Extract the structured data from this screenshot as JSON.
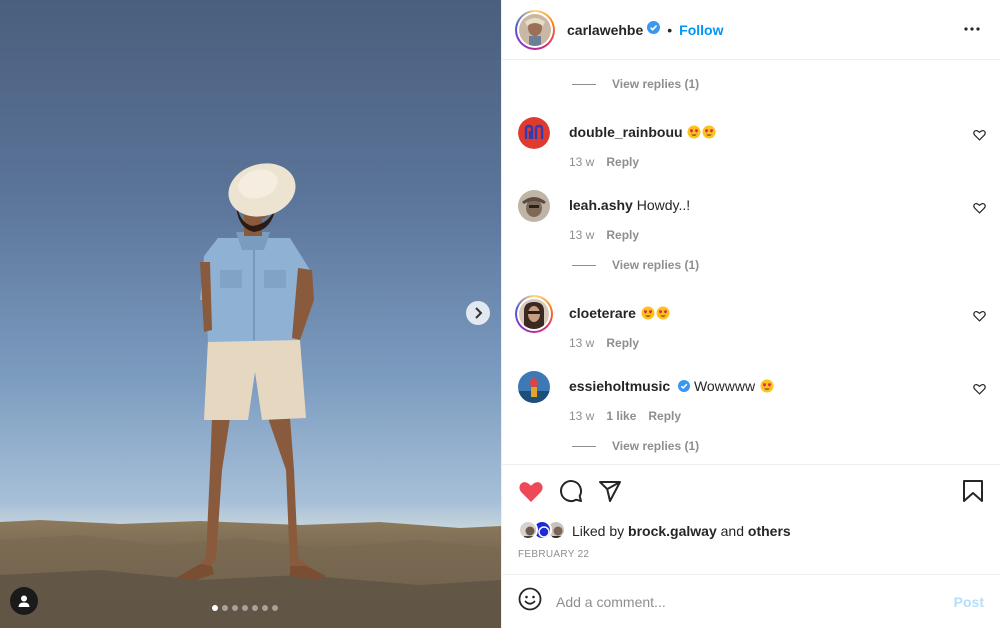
{
  "post": {
    "username": "carlawehbe",
    "dot": "•",
    "follow_label": "Follow",
    "carousel": {
      "total_slides": 7,
      "active_index": 0
    }
  },
  "comments": {
    "view_replies_1": "View replies (1)",
    "items": [
      {
        "username": "double_rainbouu",
        "text": "",
        "emojis": 2,
        "time": "13 w",
        "likes": "",
        "reply": "Reply"
      },
      {
        "username": "leah.ashy",
        "text": "Howdy..!",
        "emojis": 0,
        "time": "13 w",
        "likes": "",
        "reply": "Reply"
      },
      {
        "username": "cloeterare",
        "text": "",
        "emojis": 2,
        "time": "13 w",
        "likes": "",
        "reply": "Reply"
      },
      {
        "username": "essieholtmusic",
        "text": "Wowwww",
        "emojis": 1,
        "time": "13 w",
        "likes": "1 like",
        "reply": "Reply"
      }
    ],
    "view_replies_2": "View replies (1)",
    "view_replies_3": "View replies (1)"
  },
  "actions": {
    "liked_prefix": "Liked by",
    "liked_user": "brock.galway",
    "liked_and": "and",
    "liked_others": "others",
    "date": "FEBRUARY 22"
  },
  "add_comment": {
    "placeholder": "Add a comment...",
    "post_label": "Post"
  },
  "colors": {
    "like_red": "#ed4956",
    "follow_blue": "#0095f6",
    "post_disabled": "#b2dffc",
    "muted": "#8e8e8e"
  },
  "icons": [
    "chevron-right-icon",
    "user-tag-icon",
    "verified-badge-icon",
    "more-options-icon",
    "heart-icon",
    "comment-icon",
    "share-icon",
    "bookmark-icon",
    "emoji-icon"
  ]
}
